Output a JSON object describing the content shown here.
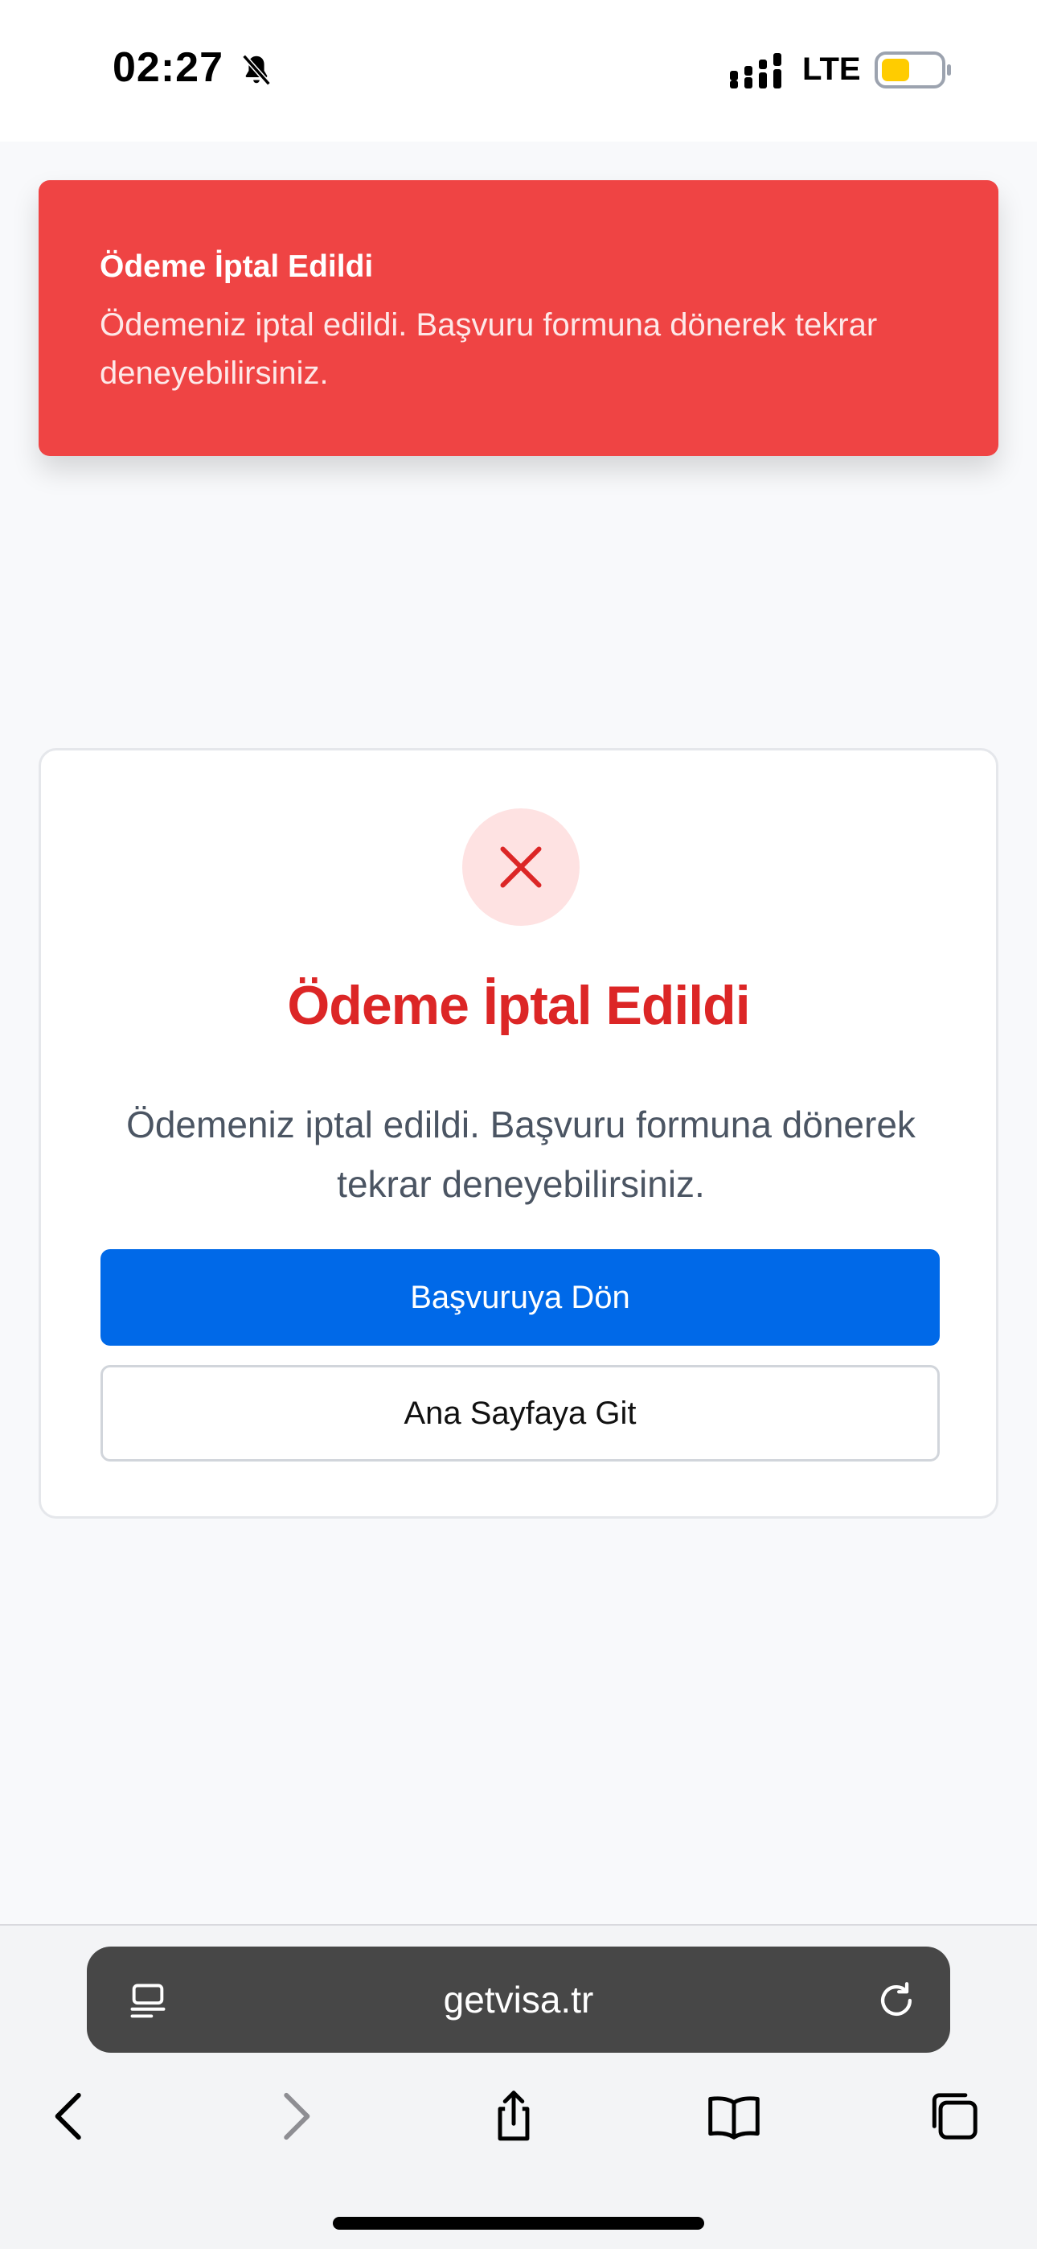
{
  "status_bar": {
    "time": "02:27",
    "network": "LTE",
    "icons": [
      "bell-slash-icon",
      "signal-icon",
      "battery-icon"
    ],
    "battery_color": "#ffcc00"
  },
  "toast": {
    "title": "Ödeme İptal Edildi",
    "message": "Ödemeniz iptal edildi. Başvuru formuna dönerek tekrar deneyebilirsiniz.",
    "background": "#ef4444"
  },
  "card": {
    "icon": "close-icon",
    "title": "Ödeme İptal Edildi",
    "message": "Ödemeniz iptal edildi. Başvuru formuna dönerek tekrar deneyebilirsiniz.",
    "primary_button": "Başvuruya Dön",
    "secondary_button": "Ana Sayfaya Git",
    "accent_color": "#dc2626",
    "primary_color": "#0069e8"
  },
  "browser": {
    "url": "getvisa.tr",
    "toolbar_icons": [
      "back-icon",
      "forward-icon",
      "share-icon",
      "bookmarks-icon",
      "tabs-icon"
    ]
  }
}
